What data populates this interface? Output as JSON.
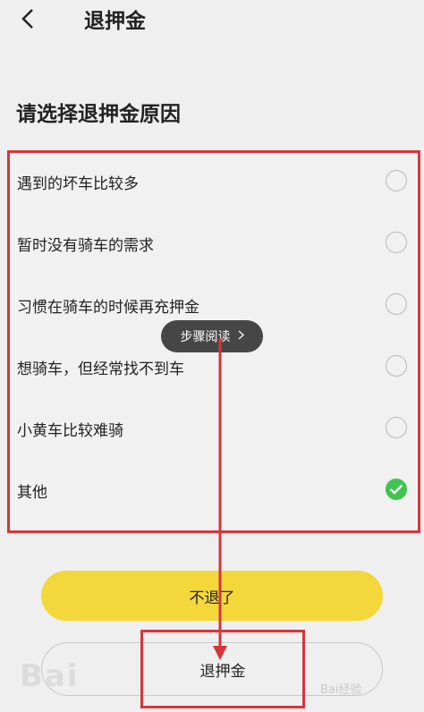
{
  "header": {
    "title": "退押金"
  },
  "section_title": "请选择退押金原因",
  "reasons": [
    {
      "label": "遇到的坏车比较多",
      "checked": false
    },
    {
      "label": "暂时没有骑车的需求",
      "checked": false
    },
    {
      "label": "习惯在骑车的时候再充押金",
      "checked": false
    },
    {
      "label": "想骑车，但经常找不到车",
      "checked": false
    },
    {
      "label": "小黄车比较难骑",
      "checked": false
    },
    {
      "label": "其他",
      "checked": true
    }
  ],
  "toast": {
    "text": "步骤阅读"
  },
  "buttons": {
    "keep": "不退了",
    "refund": "退押金"
  },
  "watermark": {
    "right": "Bai经验",
    "left": "Bai"
  },
  "colors": {
    "accent_yellow": "#f3d73b",
    "check_green": "#41c34f",
    "highlight_red": "#d6353b"
  }
}
